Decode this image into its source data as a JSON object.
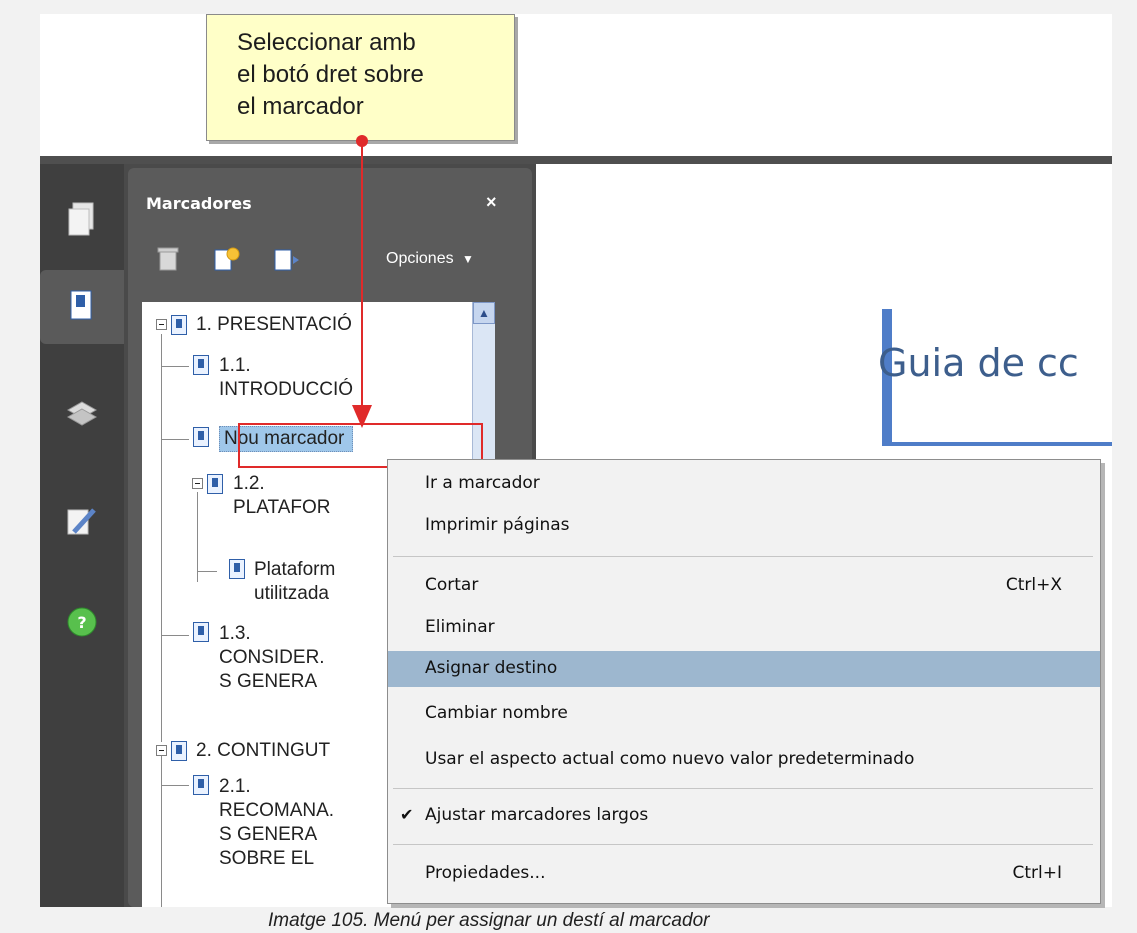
{
  "tooltip": {
    "line1": "Seleccionar amb",
    "line2": "el botó dret sobre",
    "line3": "el marcador"
  },
  "panel": {
    "title": "Marcadores",
    "close": "×",
    "options_label": "Opciones",
    "options_caret": "▼"
  },
  "tree": {
    "items": [
      {
        "label_line1": "1. PRESENTACIÓ"
      },
      {
        "label_line1": "1.1.",
        "label_line2": "INTRODUCCIÓ"
      },
      {
        "label_line1": "Nou marcador"
      },
      {
        "label_line1": "1.2.",
        "label_line2": "PLATAFOR"
      },
      {
        "label_line1": "Plataform",
        "label_line2": "utilitzada"
      },
      {
        "label_line1": "1.3.",
        "label_line2": "CONSIDER.",
        "label_line3": "S GENERA"
      },
      {
        "label_line1": "2. CONTINGUT"
      },
      {
        "label_line1": "2.1.",
        "label_line2": "RECOMANA.",
        "label_line3": "S GENERA",
        "label_line4": "SOBRE EL"
      }
    ]
  },
  "document": {
    "heading": "Guia de cc"
  },
  "context_menu": {
    "items": [
      {
        "label": "Ir a marcador",
        "shortcut": ""
      },
      {
        "label": "Imprimir páginas",
        "shortcut": ""
      },
      {
        "label": "Cortar",
        "shortcut": "Ctrl+X"
      },
      {
        "label": "Eliminar",
        "shortcut": ""
      },
      {
        "label": "Asignar destino",
        "shortcut": ""
      },
      {
        "label": "Cambiar nombre",
        "shortcut": ""
      },
      {
        "label": "Usar el aspecto actual como nuevo valor predeterminado",
        "shortcut": ""
      },
      {
        "label": "Ajustar marcadores largos",
        "shortcut": ""
      },
      {
        "label": "Propiedades...",
        "shortcut": "Ctrl+I"
      }
    ]
  },
  "caption": "Imatge 105. Menú per assignar un destí al marcador",
  "colors": {
    "highlight": "#9db7cf",
    "tooltip_bg": "#ffffc8",
    "annotation_red": "#e02a2a",
    "accent_blue": "#4f7dc8"
  }
}
